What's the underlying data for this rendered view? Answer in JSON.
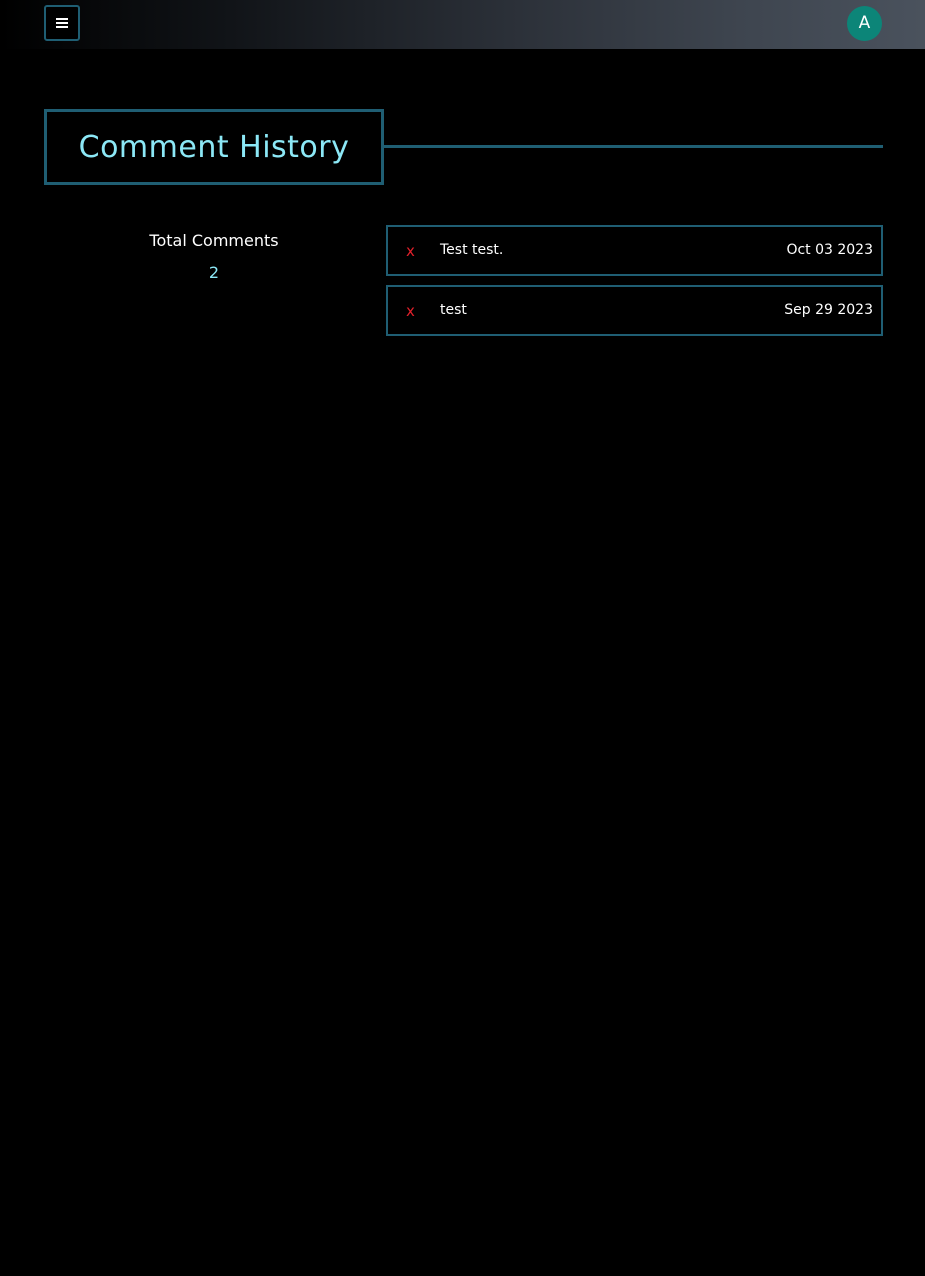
{
  "header": {
    "menu_icon": "hamburger-icon",
    "avatar_initial": "A",
    "avatar_color": "#0c8578"
  },
  "page": {
    "title": "Comment History"
  },
  "stats": {
    "label": "Total Comments",
    "value": "2"
  },
  "comments": [
    {
      "delete_label": "x",
      "text": "Test test.",
      "date": "Oct 03 2023"
    },
    {
      "delete_label": "x",
      "text": "test",
      "date": "Sep 29 2023"
    }
  ],
  "colors": {
    "accent": "#8ce8f6",
    "border": "#1f5e73",
    "delete": "#e0202a",
    "background": "#000000"
  }
}
